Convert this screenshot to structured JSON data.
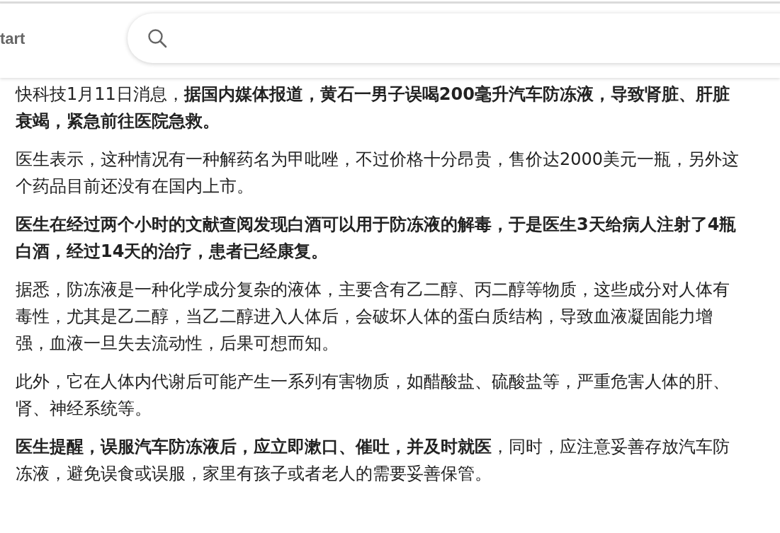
{
  "header": {
    "title": "tart"
  },
  "paragraphs": [
    {
      "text": "快科技1月11日消息，**据国内媒体报道，黄石一男子误喝200毫升汽车防冻液，导致肾脏、肝脏衰竭，紧急前往医院急救。**",
      "bold": false
    },
    {
      "text": "医生表示，这种情况有一种解药名为甲吡唑，不过价格十分昂贵，售价达2000美元一瓶，另外这个药品目前还没有在国内上市。",
      "bold": false
    },
    {
      "text": "医生在经过两个小时的文献查阅发现白酒可以用于防冻液的解毒，于是医生3天给病人注射了4瓶白酒，经过14天的治疗，患者已经康复。",
      "bold": true
    },
    {
      "text": "据悉，防冻液是一种化学成分复杂的液体，主要含有乙二醇、丙二醇等物质，这些成分对人体有毒性，尤其是乙二醇，当乙二醇进入人体后，会破坏人体的蛋白质结构，导致血液凝固能力增强，血液一旦失去流动性，后果可想而知。",
      "bold": false
    },
    {
      "text": "此外，它在人体内代谢后可能产生一系列有害物质，如醋酸盐、硫酸盐等，严重危害人体的肝、肾、神经系统等。",
      "bold": false
    },
    {
      "text": "**医生提醒，误服汽车防冻液后，应立即漱口、催吐，并及时就医**，同时，应注意妥善存放汽车防冻液，避免误食或误服，家里有孩子或者老人的需要妥善保管。",
      "bold": false
    }
  ]
}
